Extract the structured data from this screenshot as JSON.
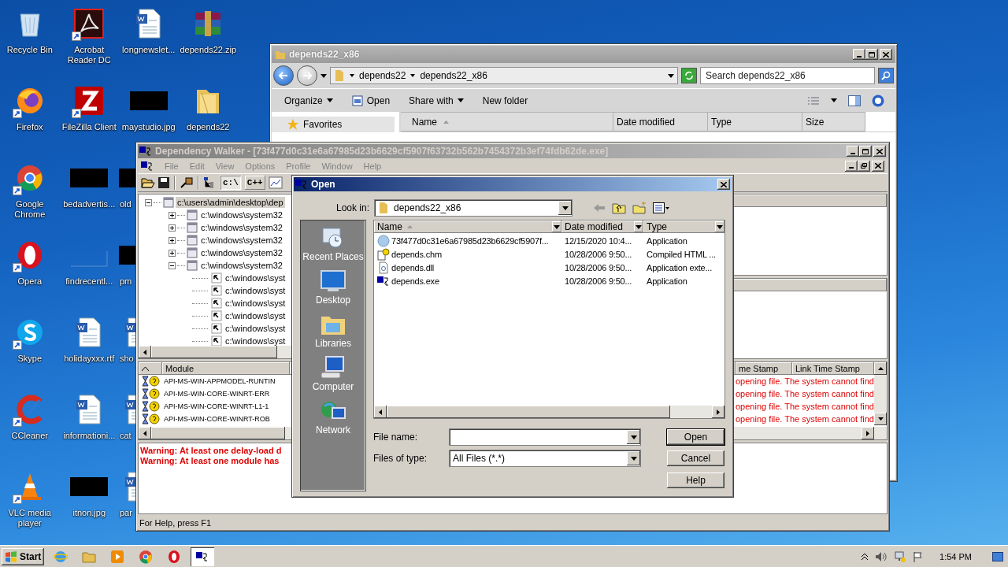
{
  "desktop": {
    "icons": [
      {
        "label": "Recycle Bin",
        "shortcut": false
      },
      {
        "label": "Firefox",
        "shortcut": true
      },
      {
        "label": "Google Chrome",
        "shortcut": true
      },
      {
        "label": "Opera",
        "shortcut": true
      },
      {
        "label": "Skype",
        "shortcut": true
      },
      {
        "label": "CCleaner",
        "shortcut": true
      },
      {
        "label": "VLC media player",
        "shortcut": true
      },
      {
        "label": "Acrobat Reader DC",
        "shortcut": true
      },
      {
        "label": "FileZilla Client",
        "shortcut": true
      },
      {
        "label": "bedadvertis...",
        "shortcut": false
      },
      {
        "label": "findrecentl...",
        "shortcut": false
      },
      {
        "label": "holidayxxx.rtf",
        "shortcut": false
      },
      {
        "label": "informationi...",
        "shortcut": false
      },
      {
        "label": "itnon.jpg",
        "shortcut": false
      },
      {
        "label": "longnewslet...",
        "shortcut": false
      },
      {
        "label": "maystudio.jpg",
        "shortcut": false
      },
      {
        "label": "old",
        "shortcut": false,
        "partly_hidden": true
      },
      {
        "label": "pm",
        "shortcut": false,
        "partly_hidden": true
      },
      {
        "label": "sho",
        "shortcut": false,
        "partly_hidden": true
      },
      {
        "label": "cat",
        "shortcut": false,
        "partly_hidden": true
      },
      {
        "label": "par",
        "shortcut": false,
        "partly_hidden": true
      },
      {
        "label": "depends22.zip",
        "shortcut": false
      },
      {
        "label": "depends22",
        "shortcut": false
      }
    ]
  },
  "explorer": {
    "title": "depends22_x86",
    "breadcrumb": [
      "depends22",
      "depends22_x86"
    ],
    "search": {
      "placeholder": "Search depends22_x86"
    },
    "toolbar": [
      {
        "label": "Organize",
        "dropdown": true,
        "icon": false
      },
      {
        "label": "Open",
        "dropdown": false,
        "icon": true
      },
      {
        "label": "Share with",
        "dropdown": true,
        "icon": false
      },
      {
        "label": "New folder",
        "dropdown": false,
        "icon": false
      }
    ],
    "nav": [
      "Favorites"
    ],
    "columns": [
      "Name",
      "Date modified",
      "Type",
      "Size"
    ]
  },
  "dependency_walker": {
    "title": "Dependency Walker - [73f477d0c31e6a67985d23b6629cf5907f63732b562b7454372b3ef74fdb62de.exe]",
    "menu": [
      "File",
      "Edit",
      "View",
      "Options",
      "Profile",
      "Window",
      "Help"
    ],
    "toolbar_buttons": [
      {
        "label": "c:\\",
        "selected": true
      },
      {
        "label": "C++",
        "selected": false
      }
    ],
    "tree": [
      {
        "label": "c:\\users\\admin\\desktop\\dep",
        "expanded": true,
        "selected": true,
        "children": [
          {
            "label": "c:\\windows\\system32",
            "expanded": false,
            "selected": false
          },
          {
            "label": "c:\\windows\\system32",
            "expanded": false,
            "selected": false
          },
          {
            "label": "c:\\windows\\system32",
            "expanded": false,
            "selected": false
          },
          {
            "label": "c:\\windows\\system32",
            "expanded": false,
            "selected": false
          },
          {
            "label": "c:\\windows\\system32",
            "expanded": true,
            "selected": false,
            "children": [
              {
                "label": "c:\\windows\\syst",
                "selected": false
              },
              {
                "label": "c:\\windows\\syst",
                "selected": false
              },
              {
                "label": "c:\\windows\\syst",
                "selected": false
              },
              {
                "label": "c:\\windows\\syst",
                "selected": false
              },
              {
                "label": "c:\\windows\\syst",
                "selected": false
              },
              {
                "label": "c:\\windows\\syst",
                "selected": false
              }
            ]
          }
        ]
      }
    ],
    "modules": {
      "columns": [
        "Module"
      ],
      "columns_right": [
        "me Stamp",
        "Link Time Stamp"
      ],
      "rows": [
        {
          "name": "API-MS-WIN-APPMODEL-RUNTIN",
          "error": "opening file. The system cannot find"
        },
        {
          "name": "API-MS-WIN-CORE-WINRT-ERR",
          "error": "opening file. The system cannot find"
        },
        {
          "name": "API-MS-WIN-CORE-WINRT-L1-1",
          "error": "opening file. The system cannot find"
        },
        {
          "name": "API-MS-WIN-CORE-WINRT-ROB",
          "error": "opening file. The system cannot find"
        }
      ]
    },
    "log": [
      "Warning: At least one delay-load d",
      "Warning: At least one module has"
    ],
    "status": "For Help, press F1"
  },
  "open_dialog": {
    "title": "Open",
    "look_in_label": "Look in:",
    "look_in": "depends22_x86",
    "places": [
      "Recent Places",
      "Desktop",
      "Libraries",
      "Computer",
      "Network"
    ],
    "columns": [
      "Name",
      "Date modified",
      "Type"
    ],
    "files": [
      {
        "name": "73f477d0c31e6a67985d23b6629cf5907f...",
        "date": "12/15/2020 10:4...",
        "type": "Application"
      },
      {
        "name": "depends.chm",
        "date": "10/28/2006 9:50...",
        "type": "Compiled HTML ..."
      },
      {
        "name": "depends.dll",
        "date": "10/28/2006 9:50...",
        "type": "Application exte..."
      },
      {
        "name": "depends.exe",
        "date": "10/28/2006 9:50...",
        "type": "Application"
      }
    ],
    "file_name_label": "File name:",
    "files_of_type_label": "Files of type:",
    "files_of_type": "All Files (*.*)",
    "buttons": [
      "Open",
      "Cancel",
      "Help"
    ]
  },
  "taskbar": {
    "start": "Start",
    "apps": [
      {
        "selected": false
      },
      {
        "selected": false
      },
      {
        "selected": false
      },
      {
        "selected": false
      },
      {
        "selected": false
      },
      {
        "selected": true
      }
    ],
    "clock": "1:54 PM"
  }
}
